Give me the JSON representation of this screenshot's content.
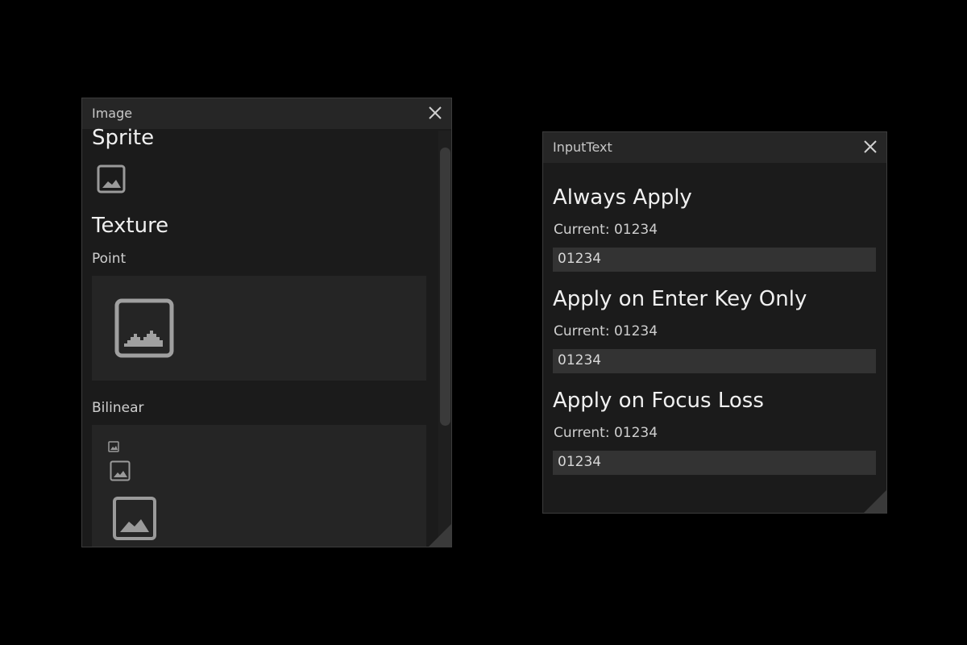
{
  "image_window": {
    "title": "Image",
    "close_label": "×",
    "sections": {
      "sprite": "Sprite",
      "texture": "Texture",
      "point": "Point",
      "bilinear": "Bilinear"
    }
  },
  "input_window": {
    "title": "InputText",
    "close_label": "×",
    "groups": [
      {
        "heading": "Always Apply",
        "current": "Current: 01234",
        "value": "01234"
      },
      {
        "heading": "Apply on Enter Key Only",
        "current": "Current: 01234",
        "value": "01234"
      },
      {
        "heading": "Apply on Focus Loss",
        "current": "Current: 01234",
        "value": "01234"
      }
    ]
  },
  "icons": {
    "image": "image-icon",
    "close": "close-icon"
  },
  "colors": {
    "background": "#000000",
    "window": "#1b1b1b",
    "titlebar": "#262626",
    "panel": "#252525",
    "input": "#333333",
    "text": "#e6e6e6"
  }
}
